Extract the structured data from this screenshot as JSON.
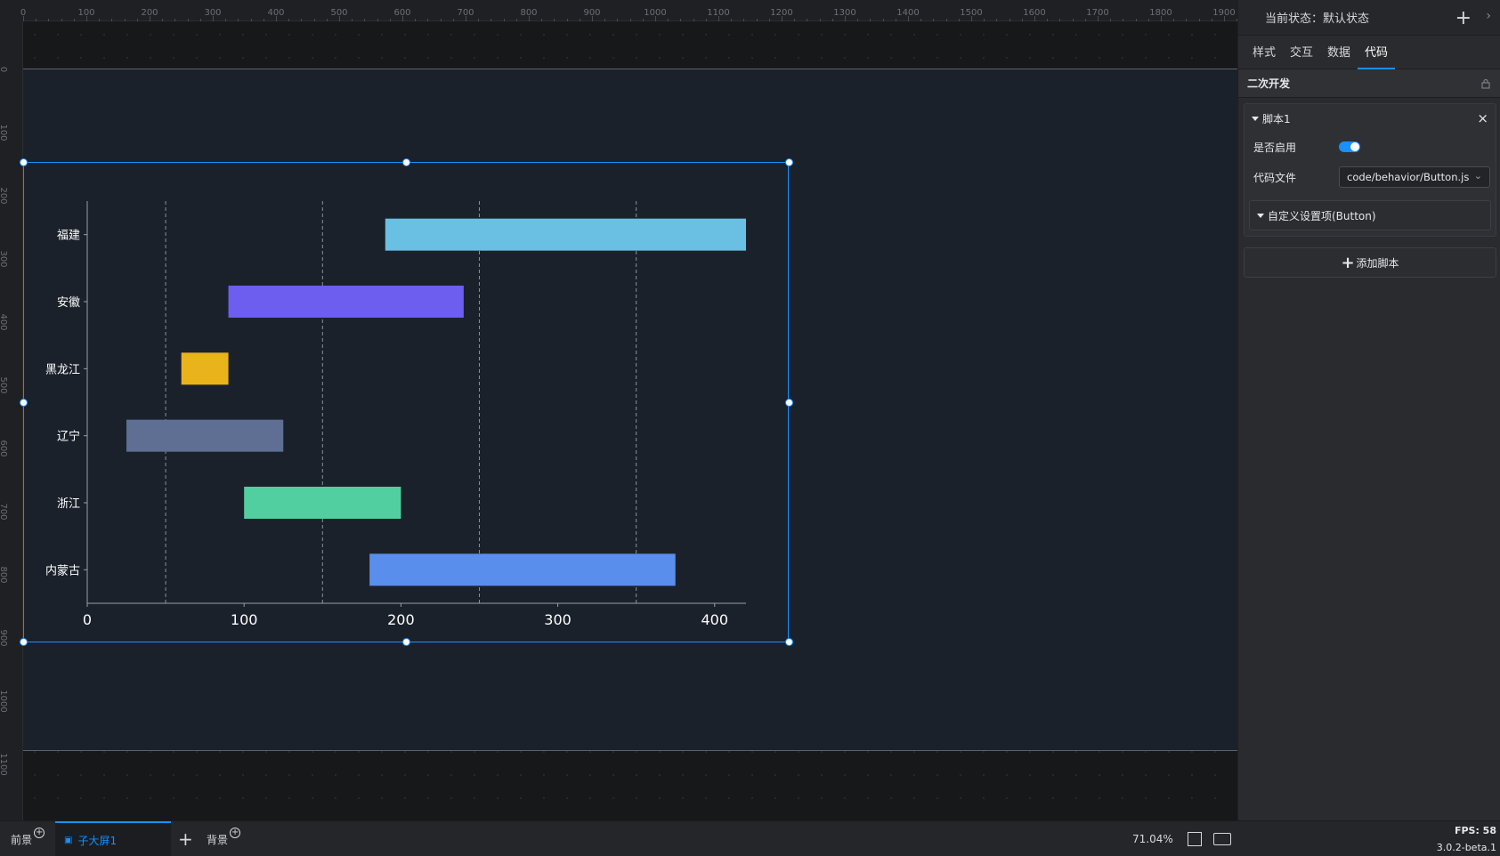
{
  "ruler": {
    "top_labels": [
      "0",
      "100",
      "200",
      "300",
      "400",
      "500",
      "600",
      "700",
      "800",
      "900",
      "1000",
      "1100",
      "1200",
      "1300",
      "1400",
      "1500",
      "1600",
      "1700",
      "1800",
      "1900"
    ],
    "left_labels": [
      "0",
      "100",
      "200",
      "300",
      "400",
      "500",
      "600",
      "700",
      "800",
      "900",
      "1000",
      "1100"
    ]
  },
  "chart_data": {
    "type": "bar",
    "orientation": "horizontal",
    "subtype": "range",
    "categories": [
      "福建",
      "安徽",
      "黑龙江",
      "辽宁",
      "浙江",
      "内蒙古"
    ],
    "ranges": [
      [
        190,
        420
      ],
      [
        90,
        240
      ],
      [
        60,
        90
      ],
      [
        25,
        125
      ],
      [
        100,
        200
      ],
      [
        180,
        375
      ]
    ],
    "colors": [
      "#69c0e2",
      "#6d5ef0",
      "#e9b31c",
      "#5e6f93",
      "#52cfa0",
      "#5a8eec"
    ],
    "x_ticks": [
      "0",
      "100",
      "200",
      "300",
      "400"
    ],
    "xlim": [
      0,
      420
    ],
    "grid": "vertical dashed at 50,150,250,350"
  },
  "panel": {
    "state_label": "当前状态：默认状态",
    "tabs": [
      "样式",
      "交互",
      "数据",
      "代码"
    ],
    "active_tab": "代码",
    "section_title": "二次开发",
    "script": {
      "title": "脚本1",
      "enabled_label": "是否启用",
      "enabled": true,
      "file_label": "代码文件",
      "file_value": "code/behavior/Button.js",
      "custom_label": "自定义设置项(Button)"
    },
    "add_script_label": "添加脚本"
  },
  "bottom": {
    "tab_foreground": "前景",
    "tab_sub": "子大屏1",
    "tab_background": "背景",
    "zoom": "71.04%",
    "fps": "FPS: 58",
    "version": "3.0.2-beta.1"
  }
}
